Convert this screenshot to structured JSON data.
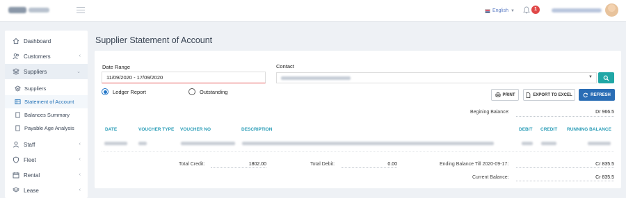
{
  "topbar": {
    "language": "English",
    "notifications": "1"
  },
  "sidebar": {
    "items": [
      {
        "label": "Dashboard",
        "icon": "home-icon"
      },
      {
        "label": "Customers",
        "icon": "users-icon"
      },
      {
        "label": "Suppliers",
        "icon": "layers-icon"
      },
      {
        "label": "Staff",
        "icon": "user-icon"
      },
      {
        "label": "Fleet",
        "icon": "shield-icon"
      },
      {
        "label": "Rental",
        "icon": "calendar-icon"
      },
      {
        "label": "Lease",
        "icon": "lease-icon"
      }
    ],
    "suppliers_sub": [
      {
        "label": "Suppliers"
      },
      {
        "label": "Statement of Account"
      },
      {
        "label": "Balances Summary"
      },
      {
        "label": "Payable Age Analysis"
      }
    ]
  },
  "page": {
    "title": "Supplier Statement of Account"
  },
  "filters": {
    "date_range_label": "Date Range",
    "date_range_value": "11/09/2020 - 17/09/2020",
    "contact_label": "Contact",
    "radio_ledger": "Ledger Report",
    "radio_outstanding": "Outstanding",
    "selected_report": "Ledger Report"
  },
  "actions": {
    "print": "PRINT",
    "export": "EXPORT TO EXCEL",
    "refresh": "REFRESH"
  },
  "balances": {
    "beginning_label": "Begining Balance:",
    "beginning_value": "Dr 966.5",
    "total_credit_label": "Total Credit:",
    "total_credit_value": "1802.00",
    "total_debit_label": "Total Debit:",
    "total_debit_value": "0.00",
    "ending_label": "Ending Balance Till 2020-09-17:",
    "ending_value": "Cr 835.5",
    "current_label": "Current Balance:",
    "current_value": "Cr 835.5"
  },
  "table": {
    "columns": [
      "DATE",
      "VOUCHER TYPE",
      "VOUCHER NO",
      "DESCRIPTION",
      "DEBIT",
      "CREDIT",
      "RUNNING BALANCE"
    ]
  },
  "colors": {
    "accent": "#2a6db5",
    "teal": "#20a7a6",
    "header_text": "#2b9db7",
    "badge": "#e04848"
  }
}
